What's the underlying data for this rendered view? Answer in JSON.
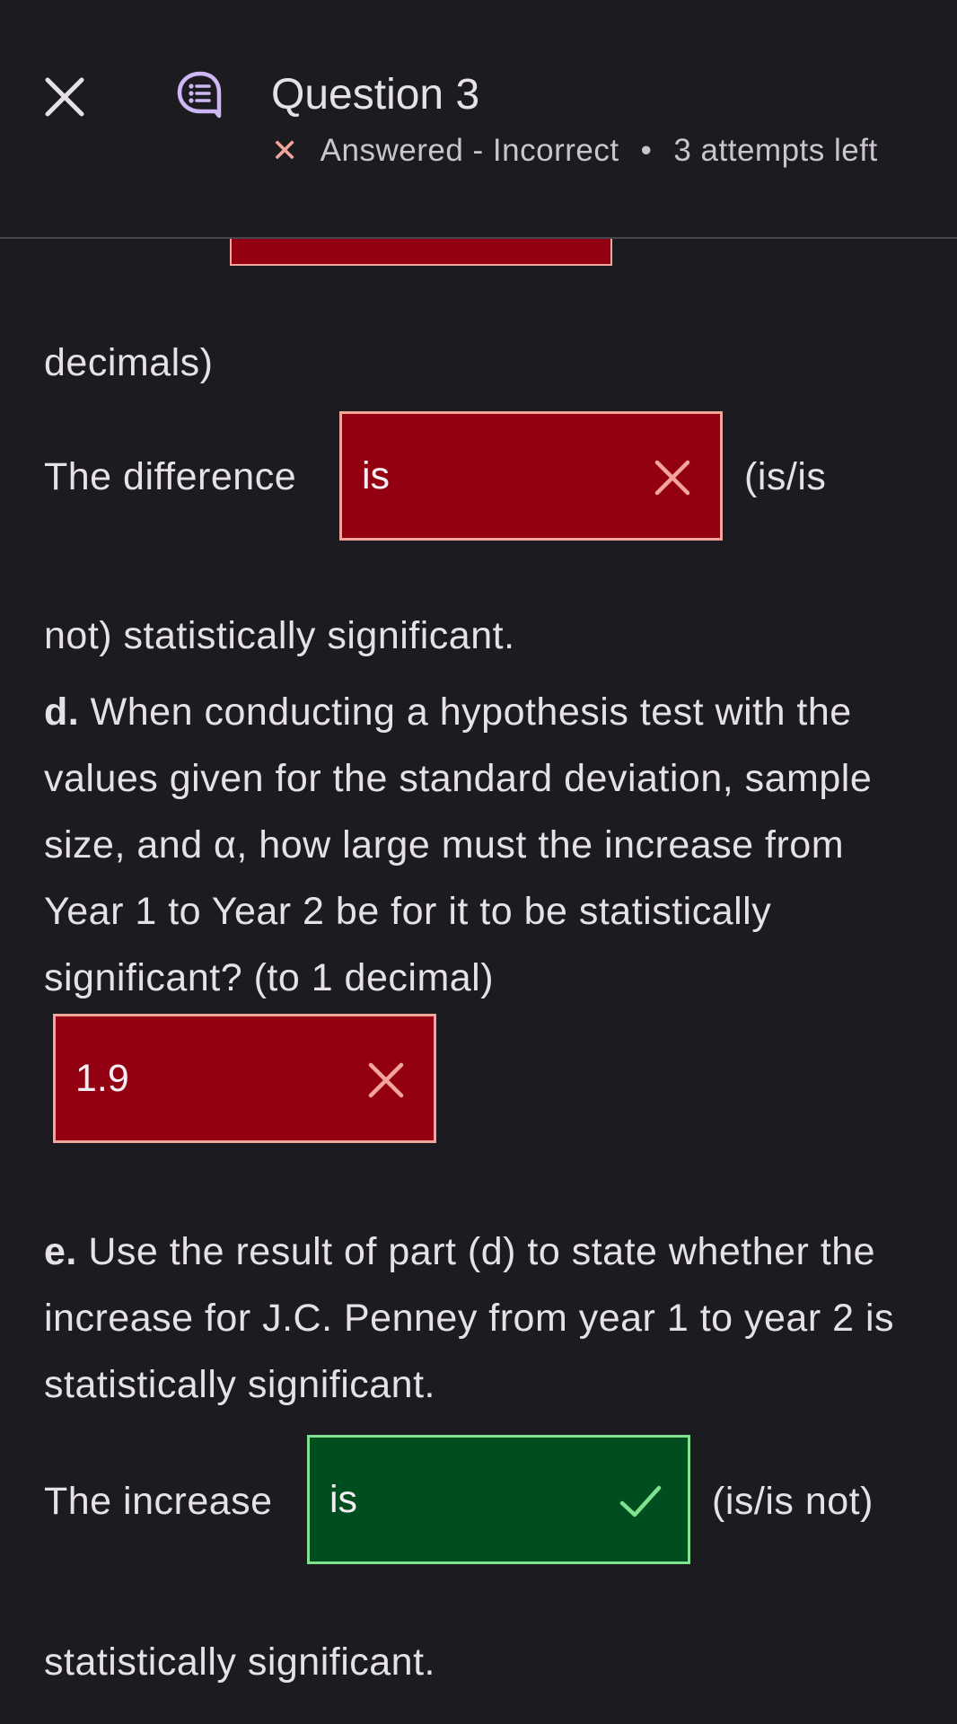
{
  "header": {
    "title": "Question 3",
    "status": "Answered - Incorrect",
    "separator": "•",
    "attempts": "3 attempts left"
  },
  "part_c": {
    "continuation": "decimals)",
    "prefix": "The difference",
    "answer": "is",
    "answer_state": "incorrect",
    "suffix": "(is/is",
    "suffix_wrap": "not) statistically significant."
  },
  "part_d": {
    "label": "d.",
    "question": "When conducting a hypothesis test with the values given for the standard deviation, sample size, and α, how large must the increase from Year 1 to Year 2 be for it to be statistically significant? (to 1 decimal)",
    "answer": "1.9",
    "answer_state": "incorrect"
  },
  "part_e": {
    "label": "e.",
    "question": "Use the result of part (d) to state whether the increase for J.C. Penney from year 1 to year 2 is statistically significant.",
    "prefix": "The increase",
    "answer": "is",
    "answer_state": "correct",
    "suffix": "(is/is not)",
    "suffix_wrap": "statistically significant."
  },
  "colors": {
    "background": "#1c1b20",
    "incorrect_fill": "#930012",
    "incorrect_border": "#f2a59a",
    "correct_fill": "#004d20",
    "correct_border": "#7ee28e",
    "question_icon": "#cdb8f5"
  },
  "icons": {
    "close": "close-icon",
    "question": "question-chat-icon",
    "incorrect": "incorrect-x-icon",
    "correct": "checkmark-icon"
  }
}
